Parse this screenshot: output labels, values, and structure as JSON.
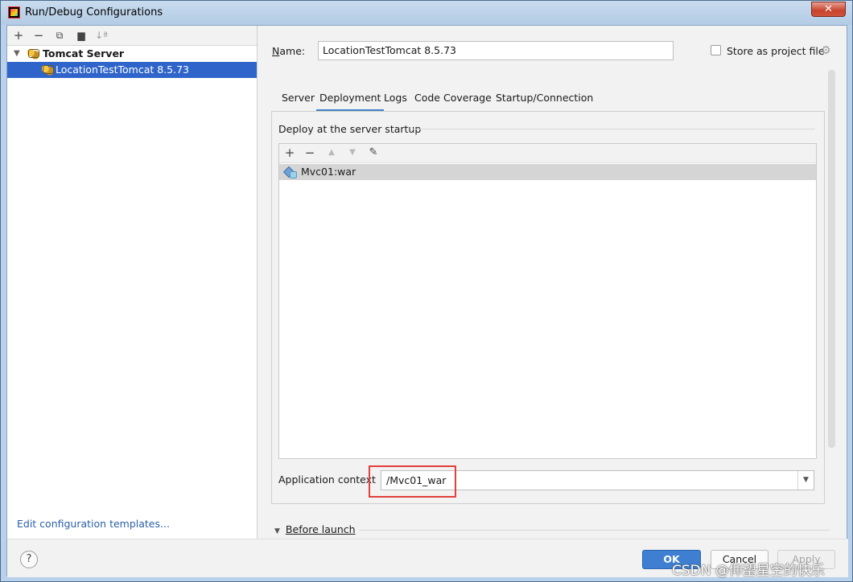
{
  "window": {
    "title": "Run/Debug Configurations",
    "close_label": "✕"
  },
  "left_toolbar": {
    "icons": [
      "add-icon",
      "remove-icon",
      "copy-icon",
      "folder-icon",
      "sort-icon"
    ]
  },
  "tree": {
    "group_label": "Tomcat Server",
    "item_label": "LocationTestTomcat 8.5.73"
  },
  "edit_templates_link": "Edit configuration templates...",
  "config": {
    "name_label": "Name:",
    "name_value": "LocationTestTomcat 8.5.73",
    "store_label": "Store as project file",
    "store_checked": false
  },
  "tabs": [
    {
      "label": "Server",
      "active": false
    },
    {
      "label": "Deployment",
      "active": true
    },
    {
      "label": "Logs",
      "active": false
    },
    {
      "label": "Code Coverage",
      "active": false
    },
    {
      "label": "Startup/Connection",
      "active": false
    }
  ],
  "deployment": {
    "section_title": "Deploy at the server startup",
    "items": [
      {
        "label": "Mvc01:war",
        "icon": "war-artifact-icon"
      }
    ],
    "context_label": "Application context",
    "context_value": "/Mvc01_war"
  },
  "before_launch_label": "Before launch",
  "buttons": {
    "help": "?",
    "ok": "OK",
    "cancel": "Cancel",
    "apply": "Apply"
  },
  "watermark": "CSDN @仰望星空的快乐",
  "colors": {
    "selection": "#2f65ca",
    "ok_button": "#3e7fd1",
    "highlight": "#e2403a"
  }
}
